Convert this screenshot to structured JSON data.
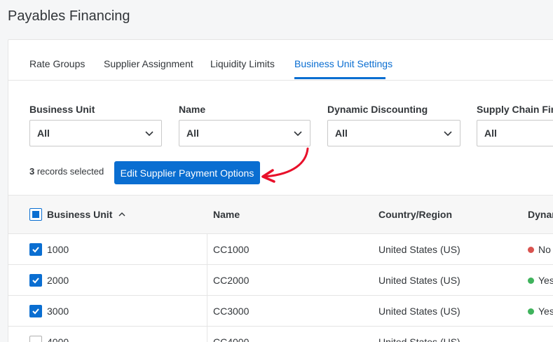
{
  "page": {
    "title": "Payables Financing"
  },
  "tabs": [
    {
      "label": "Rate Groups"
    },
    {
      "label": "Supplier Assignment"
    },
    {
      "label": "Liquidity Limits"
    },
    {
      "label": "Business Unit Settings"
    }
  ],
  "active_tab": "Business Unit Settings",
  "filters": [
    {
      "label": "Business Unit",
      "value": "All"
    },
    {
      "label": "Name",
      "value": "All"
    },
    {
      "label": "Dynamic Discounting",
      "value": "All"
    },
    {
      "label": "Supply Chain Fina",
      "value": "All"
    }
  ],
  "selection": {
    "count": "3",
    "suffix": " records selected"
  },
  "action": {
    "edit_label": "Edit Supplier Payment Options"
  },
  "table": {
    "headers": {
      "business_unit": "Business Unit",
      "name": "Name",
      "country": "Country/Region",
      "dynamic": "Dynar"
    },
    "rows": [
      {
        "business_unit": "1000",
        "name": "CC1000",
        "country": "United States (US)",
        "dynamic": "No",
        "checked": true
      },
      {
        "business_unit": "2000",
        "name": "CC2000",
        "country": "United States (US)",
        "dynamic": "Yes",
        "checked": true
      },
      {
        "business_unit": "3000",
        "name": "CC3000",
        "country": "United States (US)",
        "dynamic": "Yes",
        "checked": true
      },
      {
        "business_unit": "4000",
        "name": "CC4000",
        "country": "United States (US)",
        "dynamic": "",
        "checked": false
      }
    ]
  },
  "colors": {
    "accent": "#0a6ed1",
    "no": "#d9534f",
    "yes": "#3fb35c",
    "arrow": "#e8102a"
  }
}
